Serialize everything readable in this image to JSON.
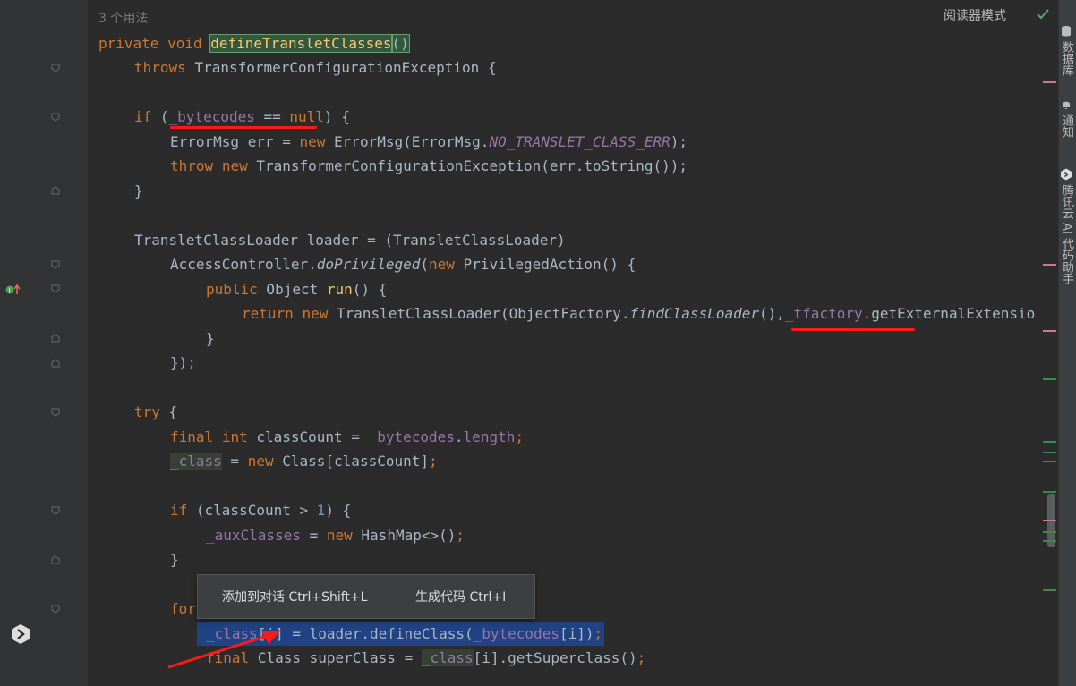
{
  "editor": {
    "usages": "3 个用法",
    "reader_mode": "阅读器模式",
    "lines": {
      "l1_private": "private",
      "l1_void": "void",
      "l1_name": "defineTransletClasses",
      "l1_paren": "()",
      "l2_throws": "throws",
      "l2_rest": " TransformerConfigurationException {",
      "l3_if": "if",
      "l3_open": " (",
      "l3_field": "_bytecodes",
      "l3_eq": " == ",
      "l3_null": "null",
      "l3_close": ") {",
      "l4_a": "ErrorMsg err = ",
      "l4_new": "new",
      "l4_b": " ErrorMsg(ErrorMsg.",
      "l4_const": "NO_TRANSLET_CLASS_ERR",
      "l4_c": ");",
      "l5_throw": "throw",
      "l5_new": "new",
      "l5_rest": " TransformerConfigurationException(err.toString());",
      "l6": "}",
      "l7": "TransletClassLoader loader = (TransletClassLoader)",
      "l8_a": "AccessController.",
      "l8_m": "doPrivileged",
      "l8_b": "(",
      "l8_new": "new",
      "l8_c": " PrivilegedAction() {",
      "l9_public": "public",
      "l9_a": " Object ",
      "l9_run": "run",
      "l9_b": "() {",
      "l10_return": "return",
      "l10_new": "new",
      "l10_a": " TransletClassLoader(ObjectFactory.",
      "l10_m": "findClassLoader",
      "l10_b": "(),",
      "l10_field": "_tfactory",
      "l10_c": ".getExternalExtensio",
      "l11": "}",
      "l12_a": "})",
      "l12_semi": ";",
      "l13_try": "try",
      "l13_b": " {",
      "l14_final": "final",
      "l14_int": "int",
      "l14_a": " classCount = ",
      "l14_field": "_bytecodes",
      "l14_b": ".",
      "l14_len": "length",
      "l14_semi": ";",
      "l15_field": "_class",
      "l15_a": " = ",
      "l15_new": "new",
      "l15_b": " Class[classCount]",
      "l15_semi": ";",
      "l16_if": "if",
      "l16_a": " (classCount > ",
      "l16_num": "1",
      "l16_b": ") {",
      "l17_field": "_auxClasses",
      "l17_a": " = ",
      "l17_new": "new",
      "l17_b": " HashMap<>()",
      "l17_semi": ";",
      "l18": "}",
      "l19_for": "for",
      "l20_field": "_class",
      "l20_a": "[i] = loader.defineClass(",
      "l20_field2": "_bytecodes",
      "l20_b": "[i])",
      "l20_semi": ";",
      "l21_final": "final",
      "l21_a": " Class superClass = ",
      "l21_field": "_class",
      "l21_b": "[i].getSuperclass()",
      "l21_semi": ";"
    }
  },
  "popup": {
    "add_to_chat": "添加到对话 Ctrl+Shift+L",
    "generate_code": "生成代码 Ctrl+I"
  },
  "side_tabs": {
    "database": "数据库",
    "notifications": "通知",
    "tencent_ai": "腾讯云 AI 代码助手"
  },
  "colors": {
    "keyword": "#cc7832",
    "field": "#9876aa",
    "method": "#ffc66d",
    "annotation_red": "#ff1a1a",
    "selection": "#214283"
  }
}
